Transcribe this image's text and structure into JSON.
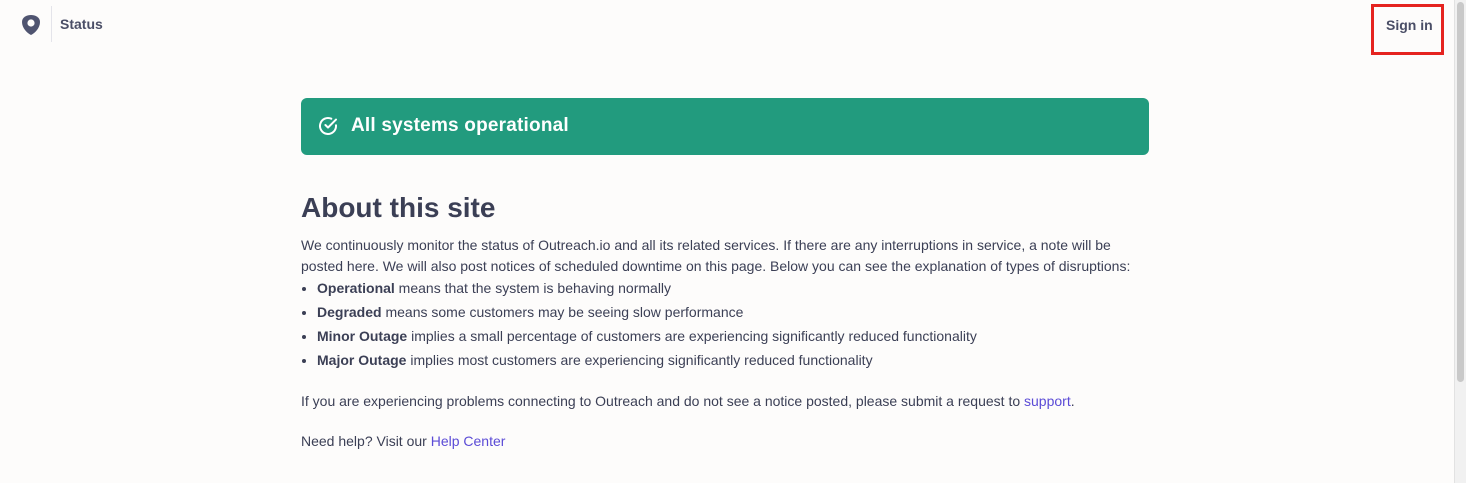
{
  "header": {
    "brand_label": "Status",
    "signin_label": "Sign in",
    "highlight_color": "#e5231f"
  },
  "status": {
    "text": "All systems operational",
    "color": "#229b7e"
  },
  "about": {
    "title": "About this site",
    "intro": "We continuously monitor the status of Outreach.io and all its related services. If there are any interruptions in service, a note will be posted here. We will also post notices of scheduled downtime on this page. Below you can see the explanation of types of disruptions:",
    "types": [
      {
        "term": "Operational",
        "description": " means that the system is behaving normally"
      },
      {
        "term": "Degraded",
        "description": " means some customers may be seeing slow performance"
      },
      {
        "term": "Minor Outage",
        "description": " implies a small percentage of customers are experiencing significantly reduced functionality"
      },
      {
        "term": "Major Outage",
        "description": " implies most customers are experiencing significantly reduced functionality"
      }
    ],
    "support_text": "If you are experiencing problems connecting to Outreach and do not see a notice posted, please submit a request to ",
    "support_link": "support",
    "support_suffix": ".",
    "help_text": "Need help? Visit our ",
    "help_link": "Help Center"
  },
  "icons": {
    "logo": "shield-logo-icon",
    "status": "check-circle-icon"
  },
  "colors": {
    "link": "#5b4bd6",
    "text": "#3b3f55"
  }
}
